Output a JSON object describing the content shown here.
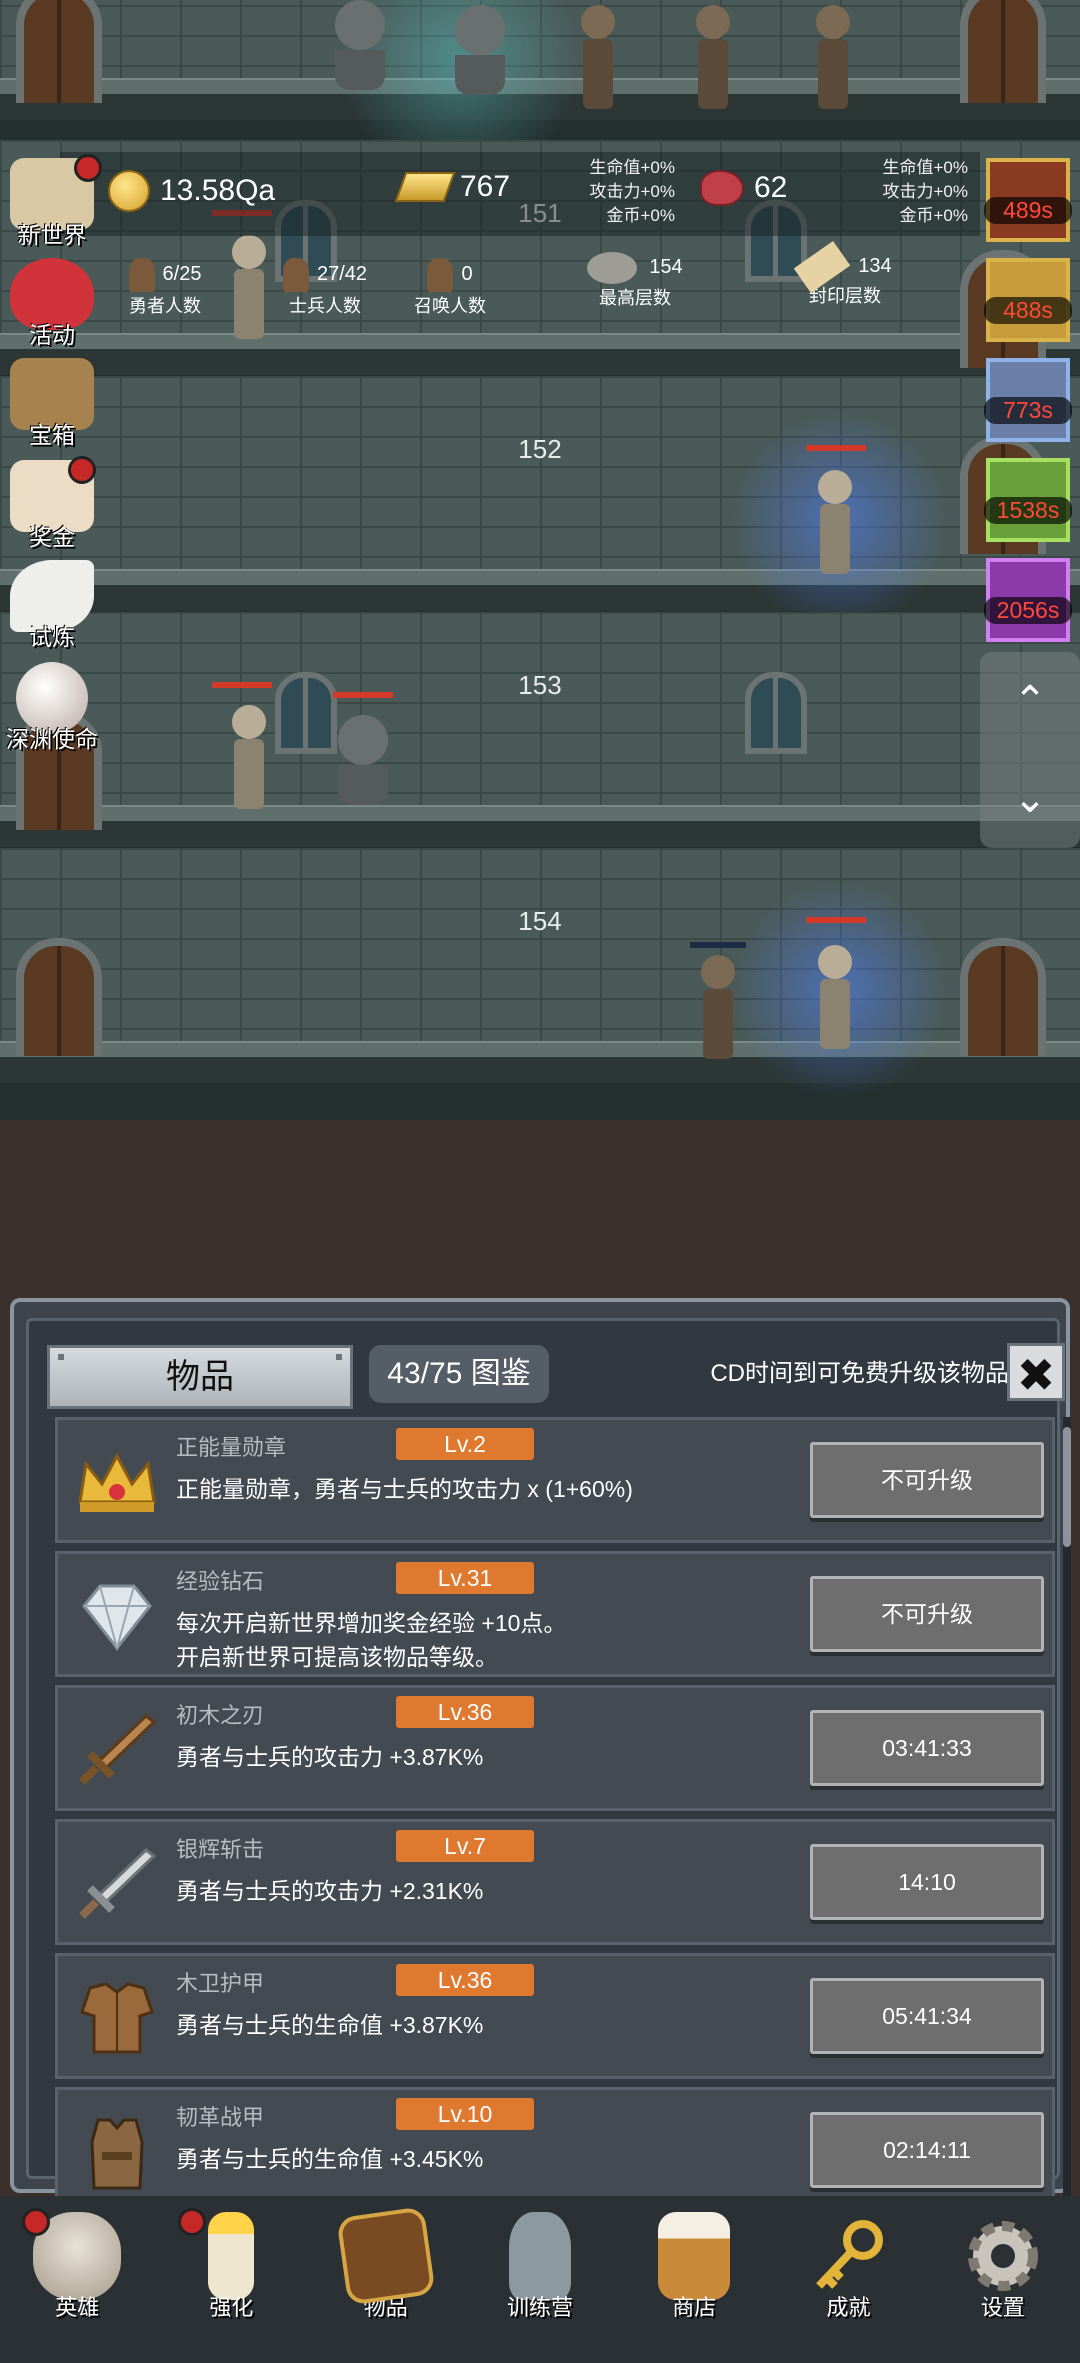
{
  "hud": {
    "gold": "13.58Qa",
    "gold_bars": "767",
    "meat": "62",
    "bonus_left": [
      "生命值+0%",
      "攻击力+0%",
      "金币+0%"
    ],
    "bonus_right": [
      "生命值+0%",
      "攻击力+0%",
      "金币+0%"
    ],
    "stats": [
      {
        "value": "6/25",
        "label": "勇者人数"
      },
      {
        "value": "27/42",
        "label": "士兵人数"
      },
      {
        "value": "0",
        "label": "召唤人数"
      },
      {
        "value": "154",
        "label": "最高层数"
      },
      {
        "value": "134",
        "label": "封印层数"
      }
    ]
  },
  "floors": [
    "151",
    "152",
    "153",
    "154"
  ],
  "side_menu": [
    "新世界",
    "活动",
    "宝箱",
    "奖金",
    "试炼",
    "深渊使命"
  ],
  "timers": [
    "489s",
    "488s",
    "773s",
    "1538s",
    "2056s"
  ],
  "scroll": {
    "up": "⌃",
    "down": "⌄"
  },
  "panel": {
    "tab": "物品",
    "count": "43/75 图鉴",
    "cd_text": "CD时间到可免费升级该物品",
    "close": "✖",
    "items": [
      {
        "name": "正能量勋章",
        "level": "Lv.2",
        "desc": [
          "正能量勋章，勇者与士兵的攻击力 x (1+60%)"
        ],
        "action": "不可升级",
        "icon": "crown-icon"
      },
      {
        "name": "经验钻石",
        "level": "Lv.31",
        "desc": [
          "每次开启新世界增加奖金经验 +10点。",
          "开启新世界可提高该物品等级。"
        ],
        "action": "不可升级",
        "icon": "diamond-icon"
      },
      {
        "name": "初木之刃",
        "level": "Lv.36",
        "desc": [
          "勇者与士兵的攻击力 +3.87K%"
        ],
        "action": "03:41:33",
        "icon": "wooden-sword-icon"
      },
      {
        "name": "银辉斩击",
        "level": "Lv.7",
        "desc": [
          "勇者与士兵的攻击力 +2.31K%"
        ],
        "action": "14:10",
        "icon": "silver-sword-icon"
      },
      {
        "name": "木卫护甲",
        "level": "Lv.36",
        "desc": [
          "勇者与士兵的生命值 +3.87K%"
        ],
        "action": "05:41:34",
        "icon": "wood-armor-icon"
      },
      {
        "name": "韧革战甲",
        "level": "Lv.10",
        "desc": [
          "勇者与士兵的生命值 +3.45K%"
        ],
        "action": "02:14:11",
        "icon": "leather-armor-icon"
      }
    ]
  },
  "nav": [
    "英雄",
    "强化",
    "物品",
    "训练营",
    "商店",
    "成就",
    "设置"
  ],
  "colors": {
    "level_badge": "#e07930",
    "timer_text": "#ff4a3a",
    "red_dot": "#c62828"
  }
}
